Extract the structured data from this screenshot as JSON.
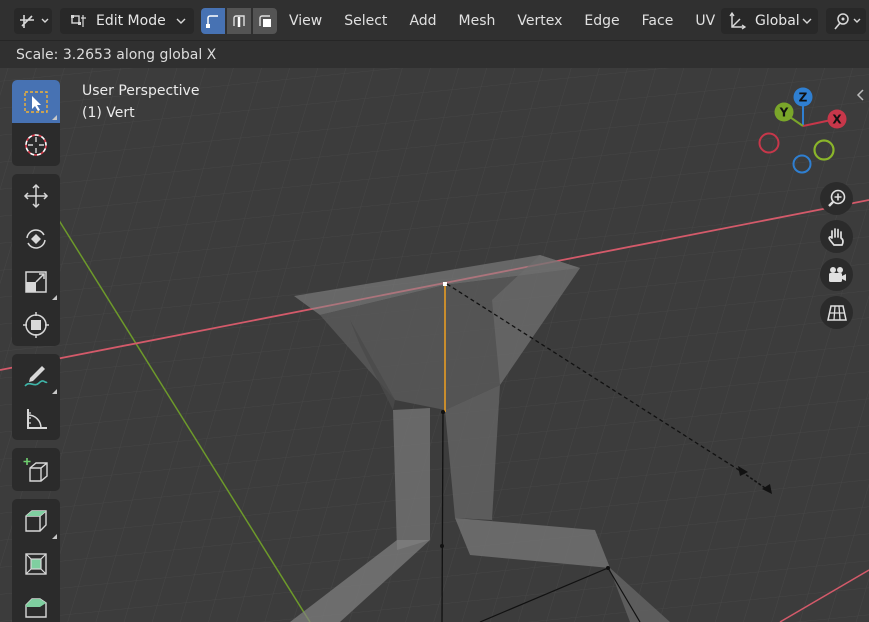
{
  "header": {
    "mode": "Edit Mode",
    "menus": [
      "View",
      "Select",
      "Add",
      "Mesh",
      "Vertex",
      "Edge",
      "Face",
      "UV"
    ],
    "orientation": "Global"
  },
  "status": {
    "text": "Scale: 3.2653 along global X"
  },
  "viewport": {
    "view_name": "User Perspective",
    "selection_info": "(1) Vert"
  },
  "gizmo": {
    "x_label": "X",
    "y_label": "Y",
    "z_label": "Z",
    "x_color": "#c7374a",
    "y_color": "#7aa62a",
    "z_color": "#2f7fd1"
  },
  "icons": {
    "toolbar": [
      "select-box-icon",
      "cursor-icon",
      "move-icon",
      "rotate-icon",
      "scale-icon",
      "transform-icon",
      "annotate-icon",
      "measure-icon",
      "add-cube-icon",
      "extrude-icon",
      "inset-icon",
      "bevel-icon"
    ],
    "nav": [
      "zoom-icon",
      "pan-hand-icon",
      "camera-icon",
      "grid-view-icon"
    ]
  },
  "colors": {
    "accent": "#4772b3",
    "x_axis_line": "#d45a6a",
    "y_axis_line": "#6d9a2a",
    "selected_edge": "#f0a020"
  }
}
